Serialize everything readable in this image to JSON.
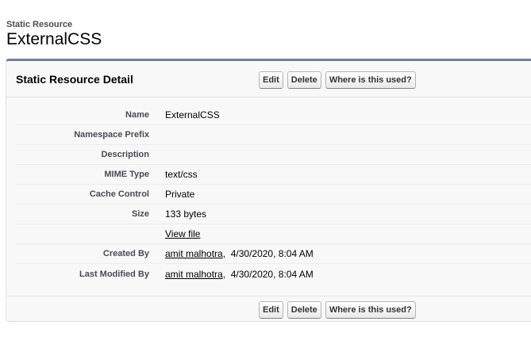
{
  "page": {
    "type_label": "Static Resource",
    "title": "ExternalCSS"
  },
  "detail": {
    "title": "Static Resource Detail",
    "buttons": {
      "edit": "Edit",
      "delete": "Delete",
      "where_used": "Where is this used?"
    },
    "fields": {
      "name": {
        "label": "Name",
        "value": "ExternalCSS"
      },
      "namespace_prefix": {
        "label": "Namespace Prefix",
        "value": ""
      },
      "description": {
        "label": "Description",
        "value": ""
      },
      "mime_type": {
        "label": "MIME Type",
        "value": "text/css"
      },
      "cache_control": {
        "label": "Cache Control",
        "value": "Private"
      },
      "size": {
        "label": "Size",
        "value": "133 bytes"
      },
      "view_file": {
        "label": "",
        "link": "View file"
      },
      "created_by": {
        "label": "Created By",
        "user": "amit malhotra",
        "date": "4/30/2020, 8:04 AM"
      },
      "last_modified_by": {
        "label": "Last Modified By",
        "user": "amit malhotra",
        "date": "4/30/2020, 8:04 AM"
      }
    }
  },
  "colors": {
    "header_border": "#747e96",
    "label_text": "#4a4a56",
    "block_bg": "#f8f8f8"
  }
}
